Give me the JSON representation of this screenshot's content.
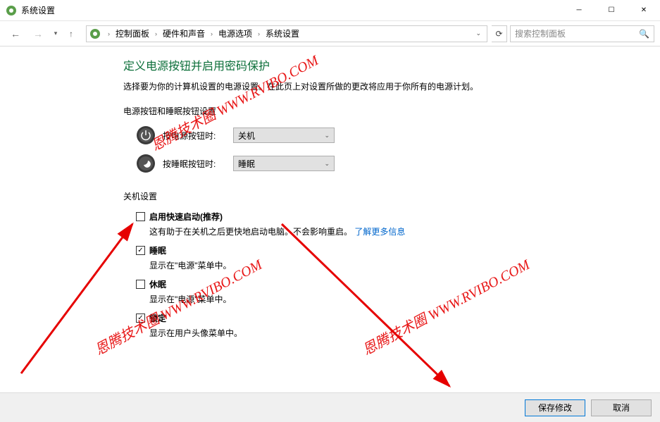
{
  "window": {
    "title": "系统设置"
  },
  "breadcrumb": {
    "items": [
      "控制面板",
      "硬件和声音",
      "电源选项",
      "系统设置"
    ]
  },
  "search": {
    "placeholder": "搜索控制面板"
  },
  "page": {
    "title": "定义电源按钮并启用密码保护",
    "description": "选择要为你的计算机设置的电源设置。在此页上对设置所做的更改将应用于你所有的电源计划。"
  },
  "power_button_section": {
    "label": "电源按钮和睡眠按钮设置",
    "power_button": {
      "label": "按电源按钮时:",
      "value": "关机"
    },
    "sleep_button": {
      "label": "按睡眠按钮时:",
      "value": "睡眠"
    }
  },
  "shutdown_section": {
    "label": "关机设置",
    "fast_startup": {
      "label": "启用快速启动(推荐)",
      "checked": false,
      "description": "这有助于在关机之后更快地启动电脑。不会影响重启。",
      "link": "了解更多信息"
    },
    "sleep": {
      "label": "睡眠",
      "checked": true,
      "description": "显示在\"电源\"菜单中。"
    },
    "hibernate": {
      "label": "休眠",
      "checked": false,
      "description": "显示在\"电源\"菜单中。"
    },
    "lock": {
      "label": "锁定",
      "checked": true,
      "description": "显示在用户头像菜单中。"
    }
  },
  "footer": {
    "save": "保存修改",
    "cancel": "取消"
  },
  "watermark": "恩腾技术圈 WWW.RVIBO.COM"
}
